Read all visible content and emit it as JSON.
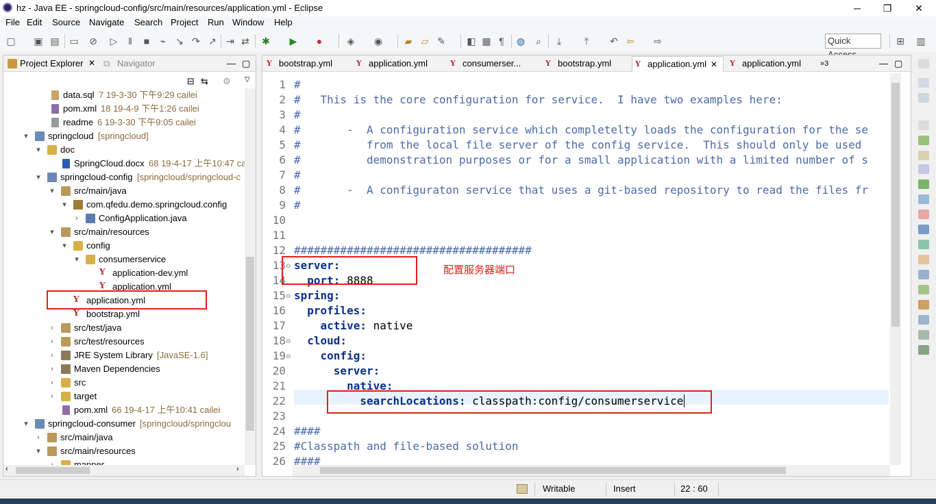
{
  "window": {
    "title": "hz - Java EE - springcloud-config/src/main/resources/application.yml - Eclipse",
    "minimize": "─",
    "maximize": "❐",
    "close": "✕"
  },
  "menu": [
    "File",
    "Edit",
    "Source",
    "Navigate",
    "Search",
    "Project",
    "Run",
    "Window",
    "Help"
  ],
  "quick_access": "Quick Access",
  "explorer": {
    "tab_label": "Project Explorer",
    "tab2_label": "Navigator",
    "rows": [
      {
        "label": "data.sql",
        "deco": "7  19-3-30 下午9:29  cailei"
      },
      {
        "label": "pom.xml",
        "deco": "18  19-4-9 下午1:26  cailei"
      },
      {
        "label": "readme",
        "deco": "6  19-3-30 下午9:05  cailei"
      },
      {
        "label": "springcloud",
        "deco": "[springcloud]"
      },
      {
        "label": "doc",
        "deco": ""
      },
      {
        "label": "SpringCloud.docx",
        "deco": "68  19-4-17 上午10:47  ca"
      },
      {
        "label": "springcloud-config",
        "deco": "[springcloud/springcloud-c"
      },
      {
        "label": "src/main/java",
        "deco": ""
      },
      {
        "label": "com.qfedu.demo.springcloud.config",
        "deco": ""
      },
      {
        "label": "ConfigApplication.java",
        "deco": ""
      },
      {
        "label": "src/main/resources",
        "deco": ""
      },
      {
        "label": "config",
        "deco": ""
      },
      {
        "label": "consumerservice",
        "deco": ""
      },
      {
        "label": "application-dev.yml",
        "deco": ""
      },
      {
        "label": "application.yml",
        "deco": ""
      },
      {
        "label": "application.yml",
        "deco": ""
      },
      {
        "label": "bootstrap.yml",
        "deco": ""
      },
      {
        "label": "src/test/java",
        "deco": ""
      },
      {
        "label": "src/test/resources",
        "deco": ""
      },
      {
        "label": "JRE System Library",
        "deco": "[JavaSE-1.6]"
      },
      {
        "label": "Maven Dependencies",
        "deco": ""
      },
      {
        "label": "src",
        "deco": ""
      },
      {
        "label": "target",
        "deco": ""
      },
      {
        "label": "pom.xml",
        "deco": "66  19-4-17 上午10:41  cailei"
      },
      {
        "label": "springcloud-consumer",
        "deco": "[springcloud/springclou"
      },
      {
        "label": "src/main/java",
        "deco": ""
      },
      {
        "label": "src/main/resources",
        "deco": ""
      },
      {
        "label": "mapper",
        "deco": ""
      }
    ]
  },
  "editor": {
    "tabs": [
      "bootstrap.yml",
      "application.yml",
      "consumerser...",
      "bootstrap.yml",
      "application.yml",
      "application.yml"
    ],
    "active_tab": 4,
    "overflow": "»3",
    "lines": [
      {
        "n": "1",
        "t": "#"
      },
      {
        "n": "2",
        "t": "#   This is the core configuration for service.  I have two examples here:"
      },
      {
        "n": "3",
        "t": "#"
      },
      {
        "n": "4",
        "t": "#       -  A configuration service which completelty loads the configuration for the se"
      },
      {
        "n": "5",
        "t": "#          from the local file server of the config service.  This should only be used"
      },
      {
        "n": "6",
        "t": "#          demonstration purposes or for a small application with a limited number of s"
      },
      {
        "n": "7",
        "t": "#"
      },
      {
        "n": "8",
        "t": "#       -  A configuraton service that uses a git-based repository to read the files fr"
      },
      {
        "n": "9",
        "t": "#"
      },
      {
        "n": "10",
        "t": ""
      },
      {
        "n": "11",
        "t": ""
      },
      {
        "n": "12",
        "t": "####################################"
      },
      {
        "n": "13",
        "k": "server:",
        "v": ""
      },
      {
        "n": "14",
        "k": "  port:",
        "v": " 8888"
      },
      {
        "n": "15",
        "k": "spring:",
        "v": ""
      },
      {
        "n": "16",
        "k": "  profiles:",
        "v": ""
      },
      {
        "n": "17",
        "k": "    active:",
        "v": " native"
      },
      {
        "n": "18",
        "k": "  cloud:",
        "v": ""
      },
      {
        "n": "19",
        "k": "    config:",
        "v": ""
      },
      {
        "n": "20",
        "k": "      server:",
        "v": ""
      },
      {
        "n": "21",
        "k": "        native:",
        "v": ""
      },
      {
        "n": "22",
        "k": "          searchLocations:",
        "v": " classpath:config/consumerservice"
      },
      {
        "n": "23",
        "t": ""
      },
      {
        "n": "24",
        "t": "####"
      },
      {
        "n": "25",
        "t": "#Classpath and file-based solution"
      },
      {
        "n": "26",
        "t": "####"
      }
    ],
    "annotation": "配置服务器端口"
  },
  "status": {
    "writable": "Writable",
    "insert": "Insert",
    "position": "22 : 60"
  },
  "colors": {
    "annotation_red": "#e0201a",
    "current_line": "#e8f2fe",
    "key_blue": "#0a2f8a",
    "comment_blue": "#4b6aa8"
  }
}
